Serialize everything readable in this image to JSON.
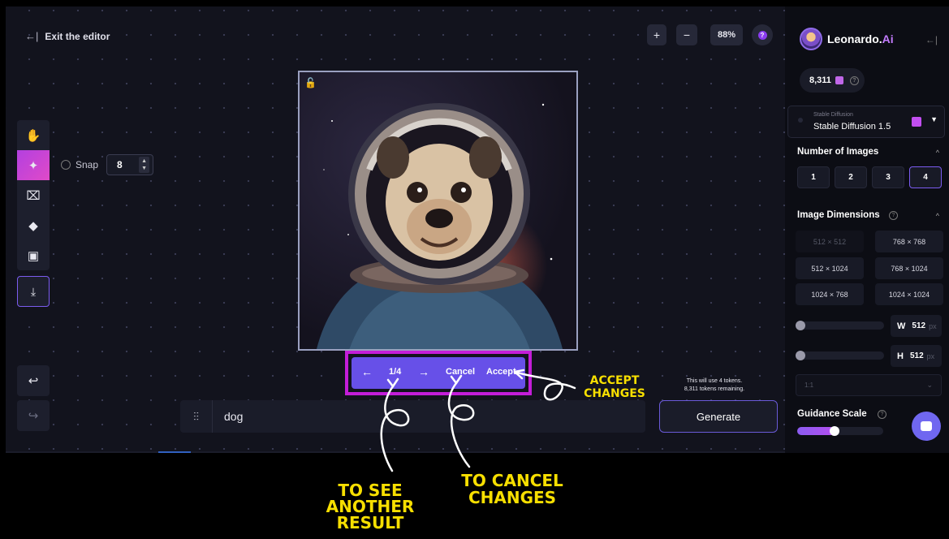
{
  "editor": {
    "exit_label": "Exit the editor",
    "exit_icon": "arrow-left-bar-icon",
    "zoom_in": "+",
    "zoom_out": "−",
    "zoom_level": "88%",
    "snap_label": "Snap",
    "snap_value": "8",
    "tools": [
      "hand-icon",
      "select-icon",
      "brush-icon",
      "eraser-icon",
      "image-icon",
      "download-icon"
    ],
    "undo": "undo-icon",
    "redo": "redo-icon"
  },
  "result_bar": {
    "prev": "←",
    "counter": "1/4",
    "next": "→",
    "cancel": "Cancel",
    "accept": "Accept"
  },
  "prompt": {
    "text": "dog",
    "token_note_line1": "This will use 4 tokens.",
    "token_note_line2": "8,311 tokens remaining.",
    "generate": "Generate"
  },
  "sidebar": {
    "brand": "Leonardo.",
    "brand_suffix": "Ai",
    "collapse": "←|",
    "tokens": "8,311",
    "model_label": "Stable Diffusion",
    "model_value": "Stable Diffusion 1.5",
    "num_images_title": "Number of Images",
    "num_images": [
      "1",
      "2",
      "3",
      "4"
    ],
    "num_images_selected": "4",
    "dimensions_title": "Image Dimensions",
    "dimensions": [
      "512 × 512",
      "768 × 768",
      "512 × 1024",
      "768 × 1024",
      "1024 × 768",
      "1024 × 1024"
    ],
    "width_label": "W",
    "width_value": "512",
    "height_label": "H",
    "height_value": "512",
    "unit": "px",
    "ratio": "1:1",
    "guidance_title": "Guidance Scale"
  },
  "annotations": {
    "next_result": [
      "TO SEE",
      "ANOTHER",
      "RESULT"
    ],
    "cancel": [
      "TO CANCEL",
      "CHANGES"
    ],
    "accept": [
      "ACCEPT",
      "CHANGES"
    ]
  },
  "colors": {
    "accent": "#6750e8",
    "highlight": "#c31dd8",
    "annotation": "#f7df00"
  }
}
